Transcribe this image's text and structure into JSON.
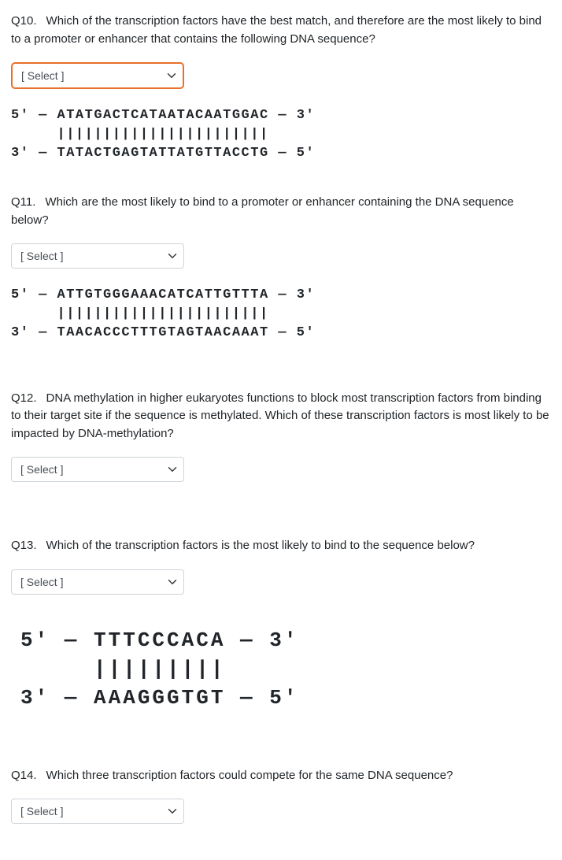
{
  "select_placeholder": "[ Select ]",
  "q10": {
    "num": "Q10.",
    "text": "Which of the transcription factors have the best match, and therefore are the most likely to bind to a promoter or enhancer that contains the following DNA sequence?",
    "sequence": "5' — ATATGACTCATAATACAATGGAC — 3'\n     |||||||||||||||||||||||\n3' — TATACTGAGTATTATGTTACCTG — 5'"
  },
  "q11": {
    "num": "Q11.",
    "text": "Which are the most likely to bind to a promoter or enhancer containing the DNA sequence below?",
    "sequence": "5' — ATTGTGGGAAACATCATTGTTTA — 3'\n     |||||||||||||||||||||||\n3' — TAACACCCTTTGTAGTAACAAAT — 5'"
  },
  "q12": {
    "num": "Q12.",
    "text": "DNA methylation in higher eukaryotes functions to block most transcription factors from binding to their target site if the sequence is methylated. Which of these transcription factors is most likely to be impacted by DNA-methylation?"
  },
  "q13": {
    "num": "Q13.",
    "text": "Which of the transcription factors is the most likely to bind to the sequence below?",
    "sequence": "5' — TTTCCCACA — 3'\n     |||||||||\n3' — AAAGGGTGT — 5'"
  },
  "q14": {
    "num": "Q14.",
    "text": "Which three transcription factors could compete for the same DNA sequence?"
  }
}
